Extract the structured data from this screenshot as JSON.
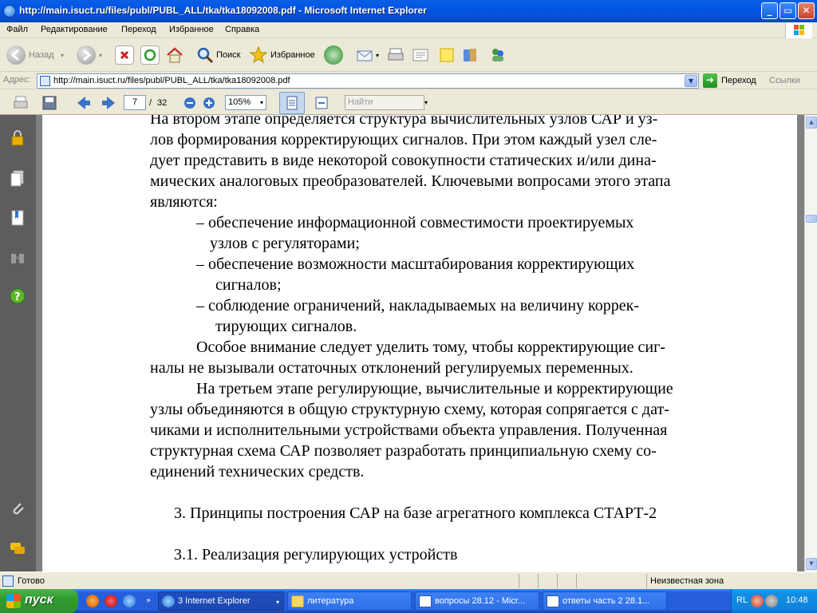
{
  "window": {
    "title": "http://main.isuct.ru/files/publ/PUBL_ALL/tka/tka18092008.pdf - Microsoft Internet Explorer",
    "min_glyph": "_",
    "max_glyph": "▭",
    "close_glyph": "✕"
  },
  "menu": [
    "Файл",
    "Редактирование",
    "Переход",
    "Избранное",
    "Справка"
  ],
  "toolbar": {
    "back_label": "Назад",
    "search_label": "Поиск",
    "favorites_label": "Избранное"
  },
  "address": {
    "label": "Адрес:",
    "url": "http://main.isuct.ru/files/publ/PUBL_ALL/tka/tka18092008.pdf",
    "go_label": "Переход",
    "links_label": "Ссылки"
  },
  "pdf_toolbar": {
    "page_current": "7",
    "page_separator": "/",
    "page_total": "32",
    "zoom": "105%",
    "find_placeholder": "Найти"
  },
  "document": {
    "lines": [
      "На втором этапе определяется структура вычислительных узлов САР и уз-",
      "лов формирования корректирующих сигналов. При этом каждый узел сле-",
      "дует представить в виде некоторой совокупности статических и/или дина-",
      "мических аналоговых преобразователей. Ключевыми вопросами этого этапа",
      "являются:",
      "– обеспечение   информационной совместимости проектируемых",
      "узлов с регуляторами;",
      "– обеспечение  возможности масштабирования корректирующих",
      "сигналов;",
      "– соблюдение  ограничений, накладываемых на величину коррек-",
      "тирующих сигналов.",
      "Особое внимание следует уделить тому, чтобы корректирующие сиг-",
      "налы не вызывали остаточных отклонений регулируемых переменных.",
      "На третьем этапе регулирующие, вычислительные и корректирующие",
      "узлы объединяются в общую структурную схему, которая сопрягается с дат-",
      "чиками и исполнительными устройствами объекта управления. Полученная",
      "структурная схема САР позволяет разработать принципиальную схему со-",
      "единений технических средств."
    ],
    "heading_3": "3. Принципы построения САР на базе агрегатного комплекса СТАРТ-2",
    "heading_31": "3.1. Реализация регулирующих устройств"
  },
  "status": {
    "text": "Готово",
    "zone": "Неизвестная зона"
  },
  "taskbar": {
    "start_label": "пуск",
    "tasks": [
      {
        "label": "3 Internet Explorer"
      },
      {
        "label": "литература"
      },
      {
        "label": "вопросы 28.12 - Micr..."
      },
      {
        "label": "ответы часть 2 28.1..."
      }
    ],
    "lang": "RL",
    "clock": "10:48"
  },
  "colors": {
    "xp_blue": "#0054e3",
    "panel_dark": "#5d5d5d",
    "doc_background": "#808080"
  }
}
